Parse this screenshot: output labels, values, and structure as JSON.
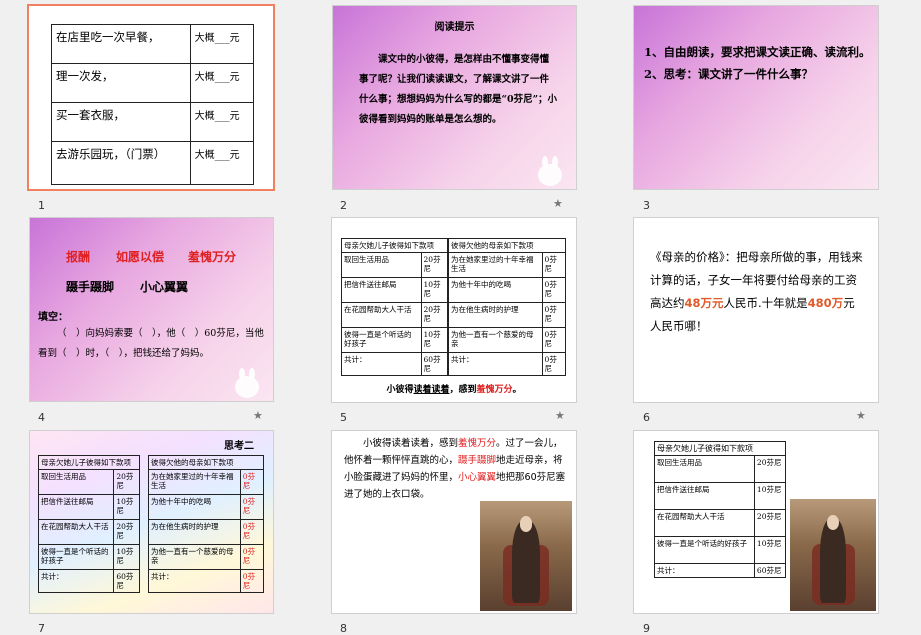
{
  "slides": [
    {
      "num": "1",
      "rows": [
        [
          "在店里吃一次早餐，",
          "大概___元"
        ],
        [
          "理一次发，",
          "大概___元"
        ],
        [
          "买一套衣服，",
          "大概___元"
        ],
        [
          "去游乐园玩，（门票）",
          "大概___元"
        ]
      ]
    },
    {
      "num": "2",
      "title": "阅读提示",
      "body": "课文中的小彼得，是怎样由不懂事变得懂事了呢？让我们读读课文，了解课文讲了一件什么事；想想妈妈为什么写的都是“0芬尼”；小彼得看到妈妈的账单是怎么想的。"
    },
    {
      "num": "3",
      "line1": "1、自由朗读，要求把课文读正确、读流利。",
      "line2": "2、思考：课文讲了一件什么事？"
    },
    {
      "num": "4",
      "words1": "报酬",
      "words2": "如愿以偿",
      "words3": "羞愧万分",
      "words4": "蹑手蹑脚",
      "words5": "小心翼翼",
      "fill_label": "填空：",
      "fill_text": "（　）向妈妈索要（　），他（　）60芬尼，当他看到（　）时，（　），把钱还给了妈妈。"
    },
    {
      "num": "5",
      "head_left": "母亲欠她儿子彼得如下款项",
      "head_right": "彼得欠他的母亲如下款项",
      "left": [
        [
          "取回生活用品",
          "20芬尼"
        ],
        [
          "把信件送往邮局",
          "10芬尼"
        ],
        [
          "在花园帮助大人干活",
          "20芬尼"
        ],
        [
          "彼得一直是个听话的好孩子",
          "10芬尼"
        ],
        [
          "共计：",
          "60芬尼"
        ]
      ],
      "right": [
        [
          "为在她家里过的十年幸福生活",
          "0芬尼"
        ],
        [
          "为他十年中的吃喝",
          "0芬尼"
        ],
        [
          "为在他生病时的护理",
          "0芬尼"
        ],
        [
          "为他一直有一个慈爱的母亲",
          "0芬尼"
        ],
        [
          "共计：",
          "0芬尼"
        ]
      ],
      "caption_a": "小彼得",
      "caption_b": "读着读着",
      "caption_c": "，感到",
      "caption_d": "羞愧万分",
      "caption_e": "。"
    },
    {
      "num": "6",
      "text_a": "《母亲的价格》：把母亲所做的事，用钱来计算的话，子女一年将要付给母亲的工资高达约",
      "v1": "48万元",
      "text_b": "人民币.十年就是",
      "v2": "480万",
      "text_c": "元人民币哪！"
    },
    {
      "num": "7",
      "title": "思考二",
      "head_left": "母亲欠她儿子彼得如下款项",
      "head_right": "彼得欠他的母亲如下款项",
      "left": [
        [
          "取回生活用品",
          "20芬尼"
        ],
        [
          "把信件送往邮局",
          "10芬尼"
        ],
        [
          "在花园帮助大人干活",
          "20芬尼"
        ],
        [
          "彼得一直是个听话的好孩子",
          "10芬尼"
        ],
        [
          "共计：",
          "60芬尼"
        ]
      ],
      "right": [
        [
          "为在她家里过的十年幸福生活",
          "0芬尼"
        ],
        [
          "为他十年中的吃喝",
          "0芬尼"
        ],
        [
          "为在他生病时的护理",
          "0芬尼"
        ],
        [
          "为他一直有一个慈爱的母亲",
          "0芬尼"
        ],
        [
          "共计：",
          "0芬尼"
        ]
      ]
    },
    {
      "num": "8",
      "t1": "小彼得读着读着，感到",
      "r1": "羞愧万分",
      "t2": "。过了一会儿，他怀着一颗怦怦直跳的心，",
      "r2": "蹑手蹑脚",
      "t3": "地走近母亲，将小脸蛋藏进了妈妈的怀里，",
      "r3": "小心翼翼",
      "t4": "地把那60芬尼塞进了她的上衣口袋。"
    },
    {
      "num": "9",
      "head": "母亲欠她儿子彼得如下款项",
      "rows": [
        [
          "取回生活用品",
          "20芬尼"
        ],
        [
          "把信件送往邮局",
          "10芬尼"
        ],
        [
          "在花园帮助大人干活",
          "20芬尼"
        ],
        [
          "彼得一直是个听话的好孩子",
          "10芬尼"
        ],
        [
          "共计：",
          "60芬尼"
        ]
      ]
    }
  ],
  "star": "★"
}
